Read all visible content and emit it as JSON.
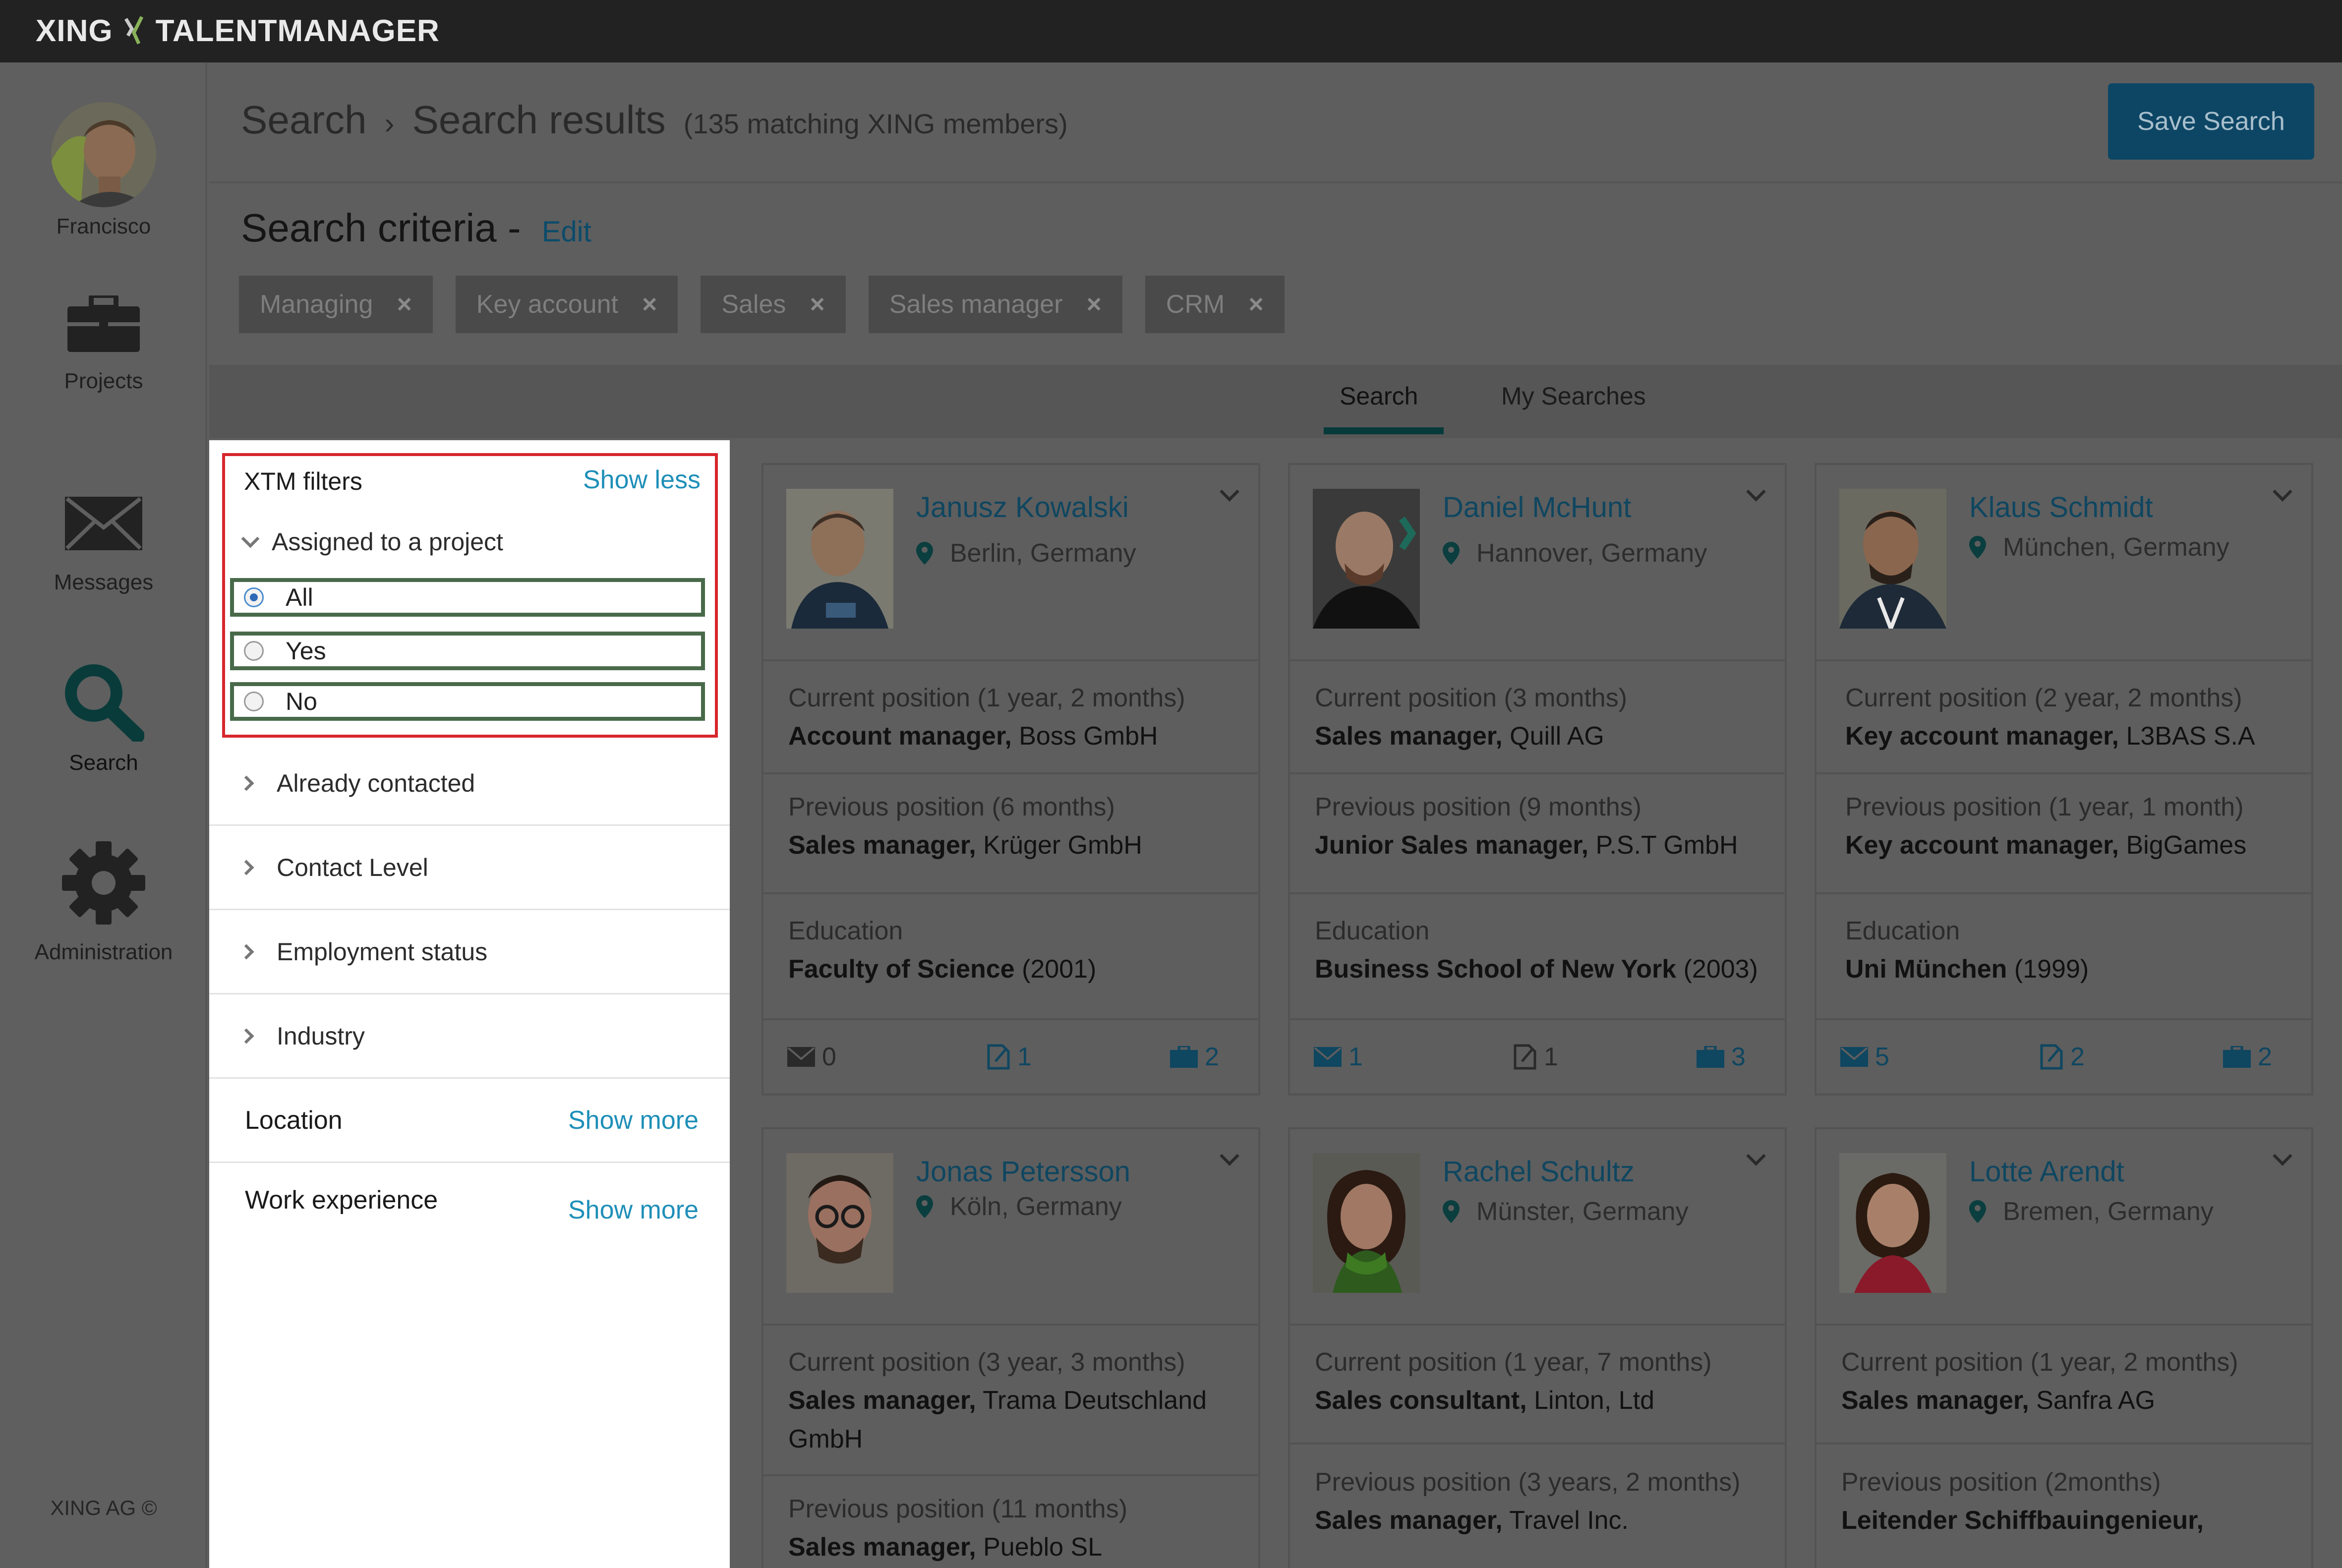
{
  "app": {
    "brand_left": "XING",
    "brand_right": "TALENTMANAGER"
  },
  "nav": {
    "user_name": "Francisco",
    "projects": "Projects",
    "messages": "Messages",
    "search": "Search",
    "administration": "Administration",
    "footer": "XING AG ©"
  },
  "header": {
    "crumb_search": "Search",
    "crumb_results": "Search results",
    "results_count": "(135 matching XING members)",
    "save_button": "Save Search"
  },
  "criteria": {
    "title": "Search criteria",
    "dash": "-",
    "edit": "Edit",
    "tags": [
      "Managing",
      "Key account",
      "Sales",
      "Sales manager",
      "CRM"
    ]
  },
  "tabs": {
    "search": "Search",
    "my_searches": "My Searches"
  },
  "filters": {
    "xtm_title": "XTM filters",
    "show_less": "Show less",
    "assigned": "Assigned to a project",
    "options": [
      "All",
      "Yes",
      "No"
    ],
    "selected": "All",
    "groups": [
      "Already contacted",
      "Contact Level",
      "Employment status",
      "Industry"
    ],
    "location": "Location",
    "work_experience": "Work experience",
    "show_more": "Show more"
  },
  "cards": [
    {
      "name": "Janusz Kowalski",
      "location": "Berlin, Germany",
      "current_head": "Current position (1 year, 2 months)",
      "current_title": "Account manager,",
      "current_company": "Boss GmbH",
      "previous_head": "Previous position (6 months)",
      "previous_title": "Sales manager,",
      "previous_company": "Krüger GmbH",
      "education_head": "Education",
      "education_school": "Faculty of Science",
      "education_year": "(2001)",
      "messages": "0",
      "notes": "1",
      "projects": "2"
    },
    {
      "name": "Daniel McHunt",
      "location": "Hannover, Germany",
      "current_head": "Current position (3 months)",
      "current_title": "Sales manager,",
      "current_company": "Quill AG",
      "previous_head": "Previous position (9 months)",
      "previous_title": "Junior Sales manager,",
      "previous_company": "P.S.T GmbH",
      "education_head": "Education",
      "education_school": "Business School of New York",
      "education_year": "(2003)",
      "messages": "1",
      "notes": "1",
      "projects": "3"
    },
    {
      "name": "Klaus Schmidt",
      "location": "München, Germany",
      "current_head": "Current position (2 year, 2 months)",
      "current_title": "Key account manager,",
      "current_company": "L3BAS S.A",
      "previous_head": "Previous position (1 year, 1 month)",
      "previous_title": "Key account manager,",
      "previous_company": "BigGames",
      "education_head": "Education",
      "education_school": "Uni München",
      "education_year": "(1999)",
      "messages": "5",
      "notes": "2",
      "projects": "2"
    },
    {
      "name": "Jonas Petersson",
      "location": "Köln, Germany",
      "current_head": "Current position (3 year, 3 months)",
      "current_title": "Sales manager,",
      "current_company": "Trama Deutschland GmbH",
      "previous_head": "Previous position (11 months)",
      "previous_title": "Sales manager,",
      "previous_company": "Pueblo SL"
    },
    {
      "name": "Rachel Schultz",
      "location": "Münster, Germany",
      "current_head": "Current position (1 year, 7 months)",
      "current_title": "Sales consultant,",
      "current_company": "Linton, Ltd",
      "previous_head": "Previous position (3 years, 2 months)",
      "previous_title": "Sales manager,",
      "previous_company": "Travel Inc."
    },
    {
      "name": "Lotte Arendt",
      "location": "Bremen, Germany",
      "current_head": "Current position (1 year, 2 months)",
      "current_title": "Sales manager,",
      "current_company": "Sanfra AG",
      "previous_head": "Previous position (2months)",
      "previous_title": "Leitender Schiffbauingenieur,",
      "previous_company": ""
    }
  ],
  "colors": {
    "accent_blue": "#0d4665",
    "link_blue": "#1e8fb8",
    "highlight_red": "#d6262c",
    "highlight_green": "#496a4a",
    "overlay_gray": "#5e5e5e"
  },
  "icons": {
    "nav": [
      "avatar",
      "briefcase-icon",
      "envelope-icon",
      "search-icon",
      "gear-icon"
    ],
    "card_stats": [
      "envelope-icon",
      "note-icon",
      "briefcase-icon"
    ]
  }
}
